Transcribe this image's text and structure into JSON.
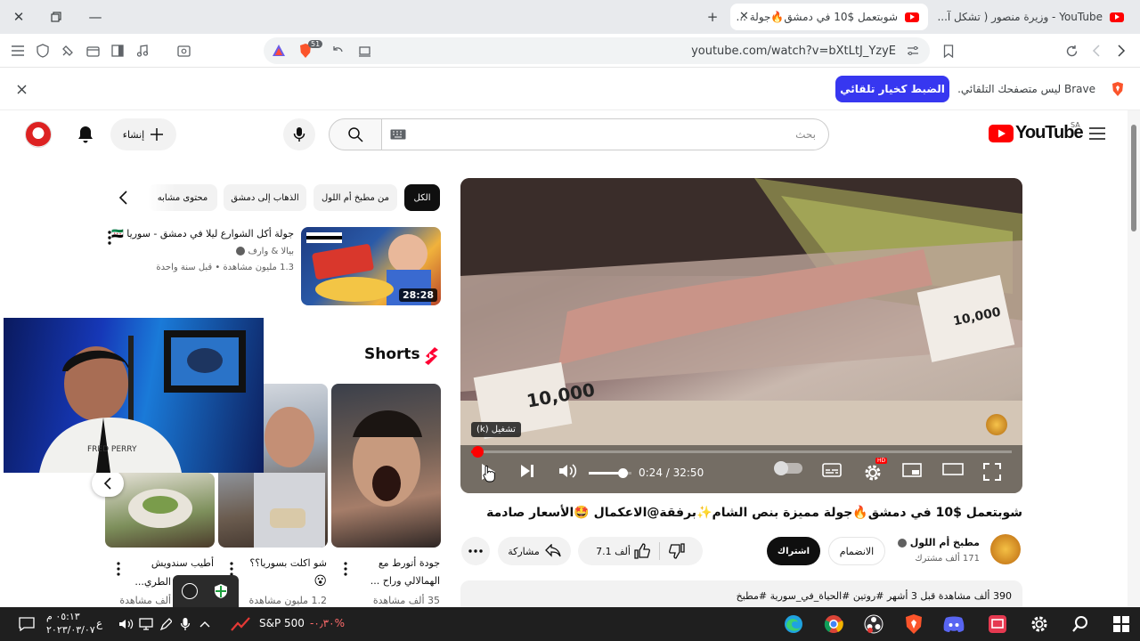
{
  "browser": {
    "tabs": [
      {
        "title": "YouTube - وزيرة منصور ( تشكل آ..."
      },
      {
        "title": "شوبتعمل $10 في دمشق🔥جولة ..."
      }
    ],
    "url": "youtube.com/watch?v=bXtLtJ_YzyE",
    "brave_badge": "51"
  },
  "infobar": {
    "message": "Brave ليس متصفحك التلقائي.",
    "button_label": "الضبط كخيار تلقائي"
  },
  "header": {
    "logo_text": "YouTube",
    "country_code": "SA",
    "search_placeholder": "بحث",
    "create_label": "إنشاء"
  },
  "player": {
    "time": "0:24 / 32:50",
    "tooltip": "تشغيل (k)",
    "watched_fraction": 0.012,
    "volume_fraction": 0.8,
    "price_tag_1": "10,000",
    "price_tag_2": "10,000"
  },
  "video": {
    "title": "شوبتعمل $10 في دمشق🔥جولة مميزة بنص الشام✨برفقة@الاعكمال 🤩الأسعار صادمة",
    "channel_name": "مطبخ أم اللول",
    "subscribers": "171 ألف مشترك",
    "join_label": "الانضمام",
    "subscribe_label": "اشتراك",
    "likes": "7.1 ألف",
    "share_label": "مشاركة",
    "description": "390 ألف مشاهدة  قبل 3 أشهر  #روتين #الحياة_في_سورية #مطبخ"
  },
  "chips": [
    "الكل",
    "من مطبخ أم اللول",
    "الذهاب إلى دمشق",
    "محتوى مشابه"
  ],
  "recommendation": {
    "title": "جولة أكل الشوارع ليلا في دمشق - سوريا 🇸🇾",
    "channel": "بيالا & وارف",
    "meta": "1.3 مليون مشاهدة • قبل سنة واحدة",
    "duration": "28:28"
  },
  "shorts": {
    "heading": "Shorts",
    "items": [
      {
        "title": "جودة أتورط مع",
        "title2": "الهمالالي وراح ...",
        "views": "35 ألف مشاهدة"
      },
      {
        "title": "شو اكلت بسوريا؟؟",
        "title2": "😮",
        "views": "1.2 مليون مشاهدة"
      },
      {
        "title": "أطيب سندويش",
        "title2": "الطري...",
        "views": "ألف مشاهدة"
      }
    ]
  },
  "taskbar": {
    "time": "٠٥:١٣ م",
    "date": "٢٠٢٣/٠٣/٠٧",
    "ticker_label": "S&P 500",
    "ticker_value": "-٠٫٣٠%",
    "lang": "ع"
  }
}
